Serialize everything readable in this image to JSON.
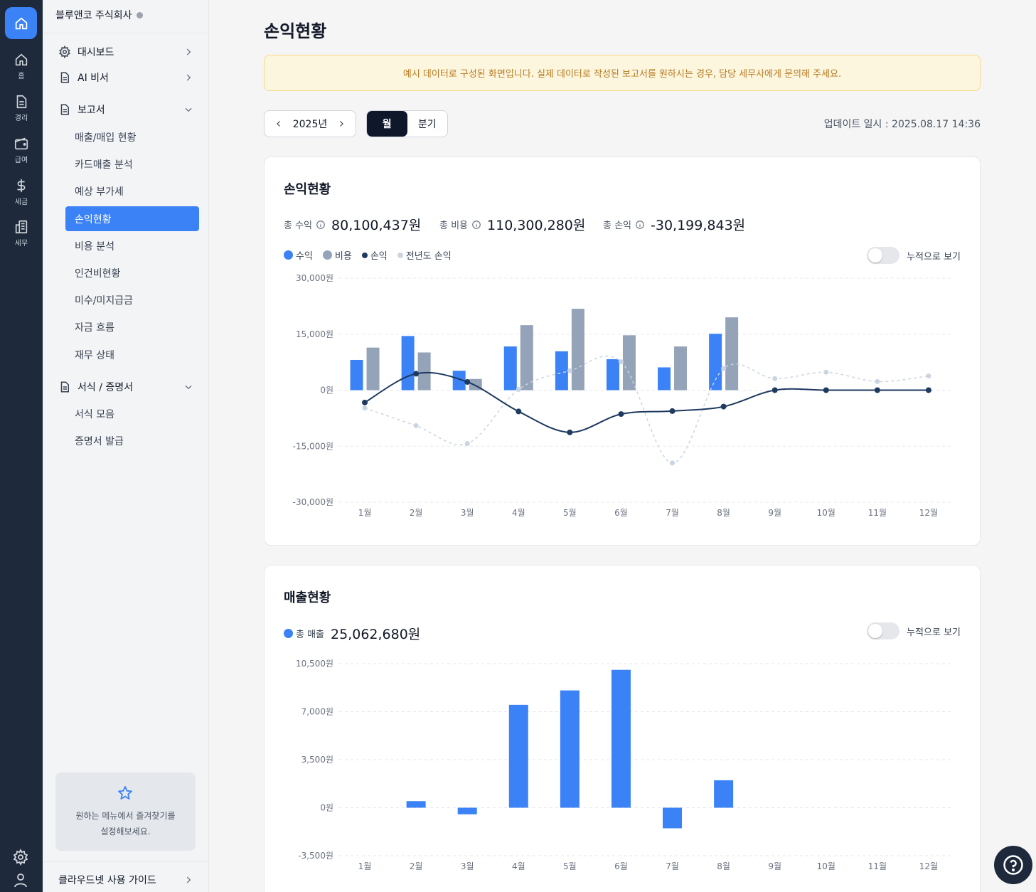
{
  "rail": {
    "items": [
      {
        "label": "홈",
        "icon": "home-icon"
      },
      {
        "label": "경리",
        "icon": "document-icon"
      },
      {
        "label": "급여",
        "icon": "wallet-icon"
      },
      {
        "label": "세금",
        "icon": "dollar-icon"
      },
      {
        "label": "세무",
        "icon": "building-icon"
      }
    ]
  },
  "sidebar": {
    "company": "블루앤코 주식회사",
    "top_menu": [
      {
        "label": "대시보드"
      },
      {
        "label": "AI 비서"
      }
    ],
    "report": {
      "label": "보고서",
      "items": [
        "매출/매입 현황",
        "카드매출 분석",
        "예상 부가세",
        "손익현황",
        "비용 분석",
        "인건비현황",
        "미수/미지급금",
        "자금 흐름",
        "재무 상태"
      ]
    },
    "forms": {
      "label": "서식 / 증명서",
      "items": [
        "서식 모음",
        "증명서 발급"
      ]
    },
    "favorites_text_1": "원하는 메뉴에서 즐겨찾기를",
    "favorites_text_2": "설정해보세요.",
    "guide": "클라우드넷 사용 가이드"
  },
  "main": {
    "title": "손익현황",
    "notice": "예시 데이터로 구성된 화면입니다. 실제 데이터로 작성된 보고서를 원하시는 경우, 담당 세무사에게 문의해 주세요.",
    "year": "2025년",
    "period_month": "월",
    "period_quarter": "분기",
    "updated": "업데이트 일시 : 2025.08.17 14:36",
    "accum_label": "누적으로 보기"
  },
  "pl_card": {
    "title": "손익현황",
    "stats": [
      {
        "label": "총 수익",
        "value": "80,100,437원"
      },
      {
        "label": "총 비용",
        "value": "110,300,280원"
      },
      {
        "label": "총 손익",
        "value": "-30,199,843원"
      }
    ]
  },
  "sales_card": {
    "title": "매출현황",
    "total_label": "총 매출",
    "total_value": "25,062,680원"
  },
  "colors": {
    "revenue": "#3b82f6",
    "cost": "#94a3b8",
    "profit": "#1e3a5f",
    "prev_profit": "#cbd5e1",
    "active": "#3b82f6"
  },
  "chart_data": [
    {
      "type": "bar",
      "title": "손익현황",
      "categories": [
        "1월",
        "2월",
        "3월",
        "4월",
        "5월",
        "6월",
        "7월",
        "8월",
        "9월",
        "10월",
        "11월",
        "12월"
      ],
      "yticks": [
        "30,000원",
        "15,000원",
        "0원",
        "-15,000원",
        "-30,000원"
      ],
      "ylim": [
        -30000,
        30000
      ],
      "grid": true,
      "legend_position": "top-left",
      "series": [
        {
          "name": "수익",
          "kind": "bar",
          "values": [
            8100,
            14500,
            5200,
            11700,
            10400,
            8300,
            6100,
            15100,
            0,
            0,
            0,
            0
          ]
        },
        {
          "name": "비용",
          "kind": "bar",
          "values": [
            11400,
            10100,
            3000,
            17400,
            21800,
            14700,
            11700,
            19500,
            0,
            0,
            0,
            0
          ]
        },
        {
          "name": "손익",
          "kind": "line",
          "values": [
            -3300,
            4400,
            2200,
            -5700,
            -11300,
            -6400,
            -5600,
            -4400,
            0,
            0,
            0,
            0
          ]
        },
        {
          "name": "전년도 손익",
          "kind": "dashed-line",
          "values": [
            -4800,
            -9500,
            -14300,
            200,
            5200,
            7600,
            -19500,
            5800,
            3100,
            4800,
            2300,
            3800
          ]
        }
      ]
    },
    {
      "type": "bar",
      "title": "매출현황",
      "categories": [
        "1월",
        "2월",
        "3월",
        "4월",
        "5월",
        "6월",
        "7월",
        "8월",
        "9월",
        "10월",
        "11월",
        "12월"
      ],
      "yticks": [
        "10,500원",
        "7,000원",
        "3,500원",
        "0원",
        "-3,500원"
      ],
      "ylim": [
        -3500,
        10500
      ],
      "grid": true,
      "series": [
        {
          "name": "총 매출",
          "values": [
            0,
            480,
            -480,
            7500,
            8550,
            10050,
            -1500,
            2000,
            0,
            0,
            0,
            0
          ]
        }
      ]
    }
  ]
}
